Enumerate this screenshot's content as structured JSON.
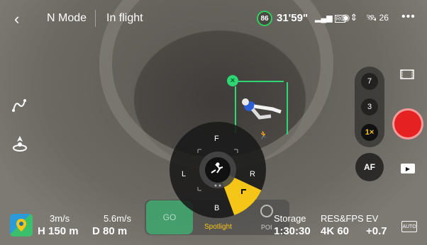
{
  "topbar": {
    "back_icon": "‹",
    "mode": "N Mode",
    "status": "In flight",
    "battery_percent": "86",
    "flight_time": "31'59\"",
    "signal_label": "RC",
    "signal_icon": "signal-bars-icon",
    "obstacle_icon": "obstacle-sensing-icon",
    "satellite_count": "26",
    "more_icon": "•••"
  },
  "left_controls": {
    "route_icon": "route-icon",
    "return_home_icon": "return-to-home-icon"
  },
  "tracking": {
    "cancel_glyph": "×"
  },
  "zoom": {
    "options": [
      "7",
      "3",
      "1×"
    ],
    "active": "1×"
  },
  "camera": {
    "af_label": "AF",
    "video_icon": "film-icon",
    "playback_icon": "playback-icon",
    "shutter_color": "#e62121"
  },
  "wheel": {
    "labels": {
      "forward": "F",
      "back": "B",
      "left": "L",
      "right": "R"
    },
    "center_icon": "subject-runner-icon",
    "active_segment_color": "#f5c518"
  },
  "spotlight_bar": {
    "go_label": "GO",
    "spotlight_label": "Spotlight",
    "poi_label": "POI"
  },
  "telemetry": {
    "horizontal_speed": "3m/s",
    "vertical_speed": "5.6m/s",
    "height_label": "H",
    "height_value": "150 m",
    "distance_label": "D",
    "distance_value": "80 m",
    "storage_label": "Storage",
    "storage_value": "1:30:30",
    "resfps_label": "RES&FPS",
    "resfps_value": "4K 60",
    "ev_label": "EV",
    "ev_value": "+0.7",
    "auto_label": "AUTO"
  },
  "colors": {
    "accent_green": "#2ed674",
    "accent_yellow": "#f5c518",
    "record_red": "#e62121"
  }
}
